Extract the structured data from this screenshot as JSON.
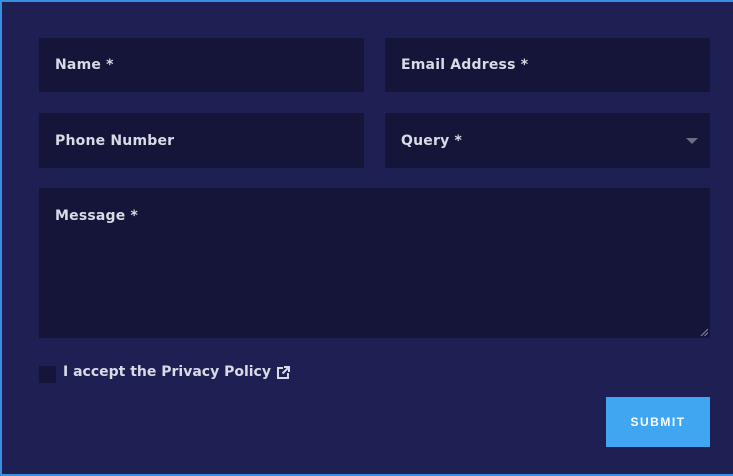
{
  "form": {
    "name_placeholder": "Name *",
    "email_placeholder": "Email Address *",
    "phone_placeholder": "Phone Number",
    "query_selected": "Query *",
    "message_placeholder": "Message *",
    "privacy_label": "I accept the Privacy Policy",
    "submit_label": "SUBMIT"
  },
  "icons": {
    "query_dropdown": "chevron-down-icon",
    "privacy_link": "external-link-icon",
    "message_resize": "resize-handle-icon"
  },
  "colors": {
    "background": "#1e1f52",
    "field_background": "#141538",
    "text": "#d8dbe6",
    "accent": "#41a6f2",
    "border": "#3a8ee0"
  }
}
